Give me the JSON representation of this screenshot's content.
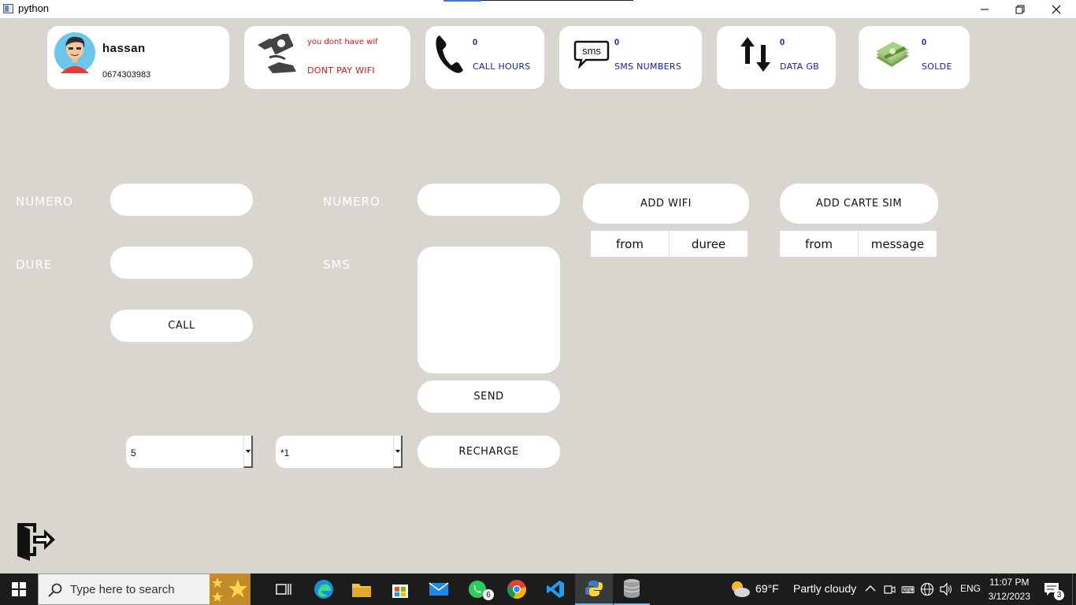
{
  "window": {
    "title": "python"
  },
  "profile": {
    "name": "hassan",
    "phone": "0674303983"
  },
  "wifi_card": {
    "status_line1": "you dont have wif",
    "status_line2": "DONT PAY WIFI"
  },
  "stats": [
    {
      "value": "0",
      "label": "CALL HOURS",
      "icon": "phone-icon"
    },
    {
      "value": "0",
      "label": "SMS NUMBERS",
      "icon": "sms-bubble-icon"
    },
    {
      "value": "0",
      "label": "DATA GB",
      "icon": "up-down-arrows-icon"
    },
    {
      "value": "0",
      "label": "SOLDE",
      "icon": "money-stack-icon"
    }
  ],
  "call_form": {
    "numero_label": "NUMERO",
    "dure_label": "DURE",
    "call_button": "CALL"
  },
  "sms_form": {
    "numero_label": "NUMERO",
    "sms_label": "SMS",
    "send_button": "SEND"
  },
  "recharge": {
    "amount_value": "5",
    "code_value": "*1",
    "button": "RECHARGE"
  },
  "wifi_panel": {
    "button": "ADD WIFI",
    "columns": [
      "from",
      "duree"
    ]
  },
  "sim_panel": {
    "button": "ADD CARTE SIM",
    "columns": [
      "from",
      "message"
    ]
  },
  "logout": {
    "icon": "logout-door-icon"
  },
  "taskbar": {
    "search_placeholder": "Type here to search",
    "weather_temp": "69°F",
    "weather_text": "Partly cloudy",
    "lang": "ENG",
    "time": "11:07 PM",
    "date": "3/12/2023",
    "whatsapp_badge": "6",
    "notifications_badge": "3"
  }
}
